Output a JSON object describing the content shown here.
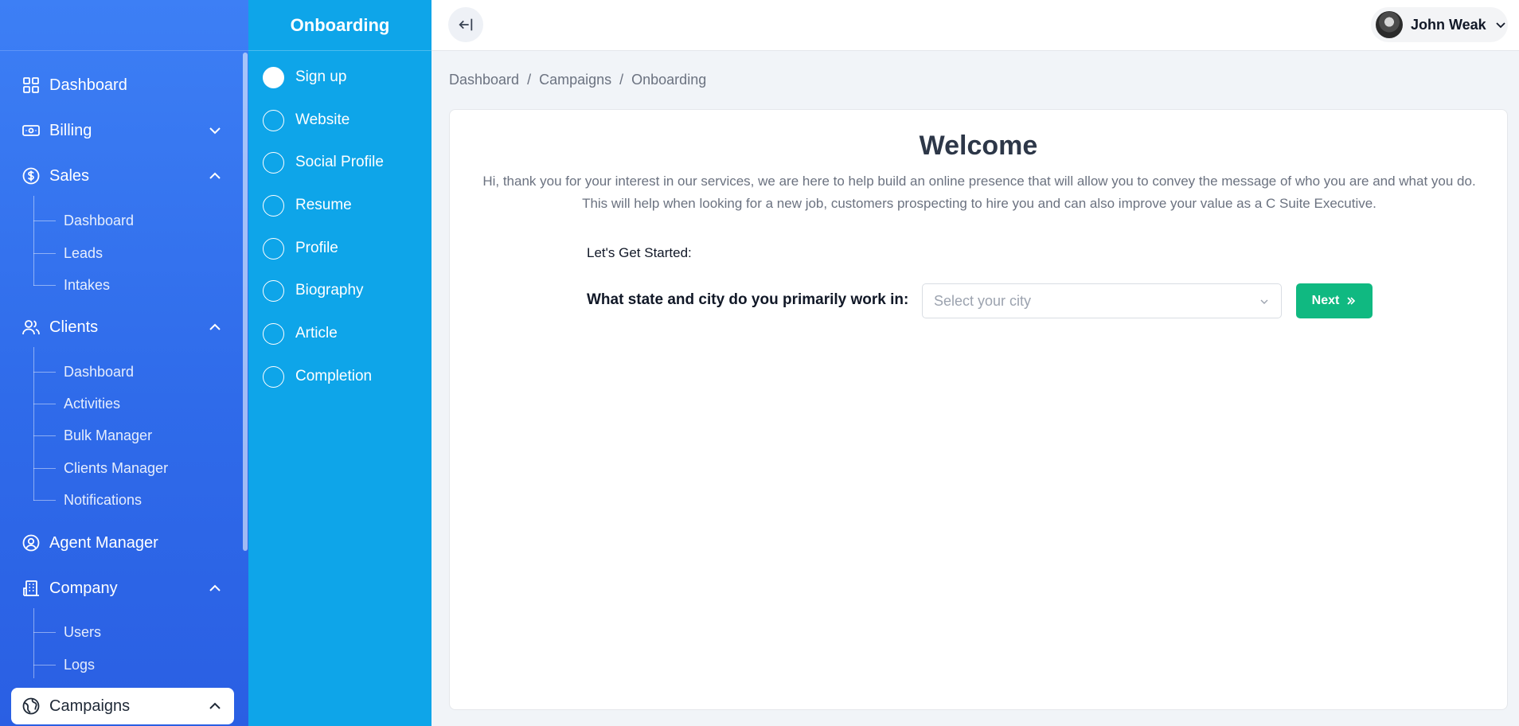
{
  "sidebar": {
    "items": [
      {
        "label": "Dashboard",
        "icon": "dashboard-grid-icon"
      },
      {
        "label": "Billing",
        "icon": "billing-card-icon",
        "expanded": false
      },
      {
        "label": "Sales",
        "icon": "dollar-circle-icon",
        "expanded": true,
        "children": [
          "Dashboard",
          "Leads",
          "Intakes"
        ]
      },
      {
        "label": "Clients",
        "icon": "users-icon",
        "expanded": true,
        "children": [
          "Dashboard",
          "Activities",
          "Bulk Manager",
          "Clients Manager",
          "Notifications"
        ]
      },
      {
        "label": "Agent Manager",
        "icon": "user-circle-icon"
      },
      {
        "label": "Company",
        "icon": "building-icon",
        "expanded": true,
        "children": [
          "Users",
          "Logs"
        ]
      },
      {
        "label": "Campaigns",
        "icon": "globe-icon",
        "expanded": true,
        "active": true
      }
    ]
  },
  "stepper": {
    "title": "Onboarding",
    "steps": [
      {
        "label": "Sign up",
        "done": true
      },
      {
        "label": "Website",
        "done": false
      },
      {
        "label": "Social Profile",
        "done": false
      },
      {
        "label": "Resume",
        "done": false
      },
      {
        "label": "Profile",
        "done": false
      },
      {
        "label": "Biography",
        "done": false
      },
      {
        "label": "Article",
        "done": false
      },
      {
        "label": "Completion",
        "done": false
      }
    ]
  },
  "header": {
    "user_name": "John Weak"
  },
  "breadcrumb": {
    "items": [
      "Dashboard",
      "Campaigns",
      "Onboarding"
    ],
    "separator": "/"
  },
  "main": {
    "title": "Welcome",
    "intro": "Hi, thank you for your interest in our services, we are here to help build an online presence that will allow you to convey the message of who you are and what you do. This will help when looking for a new job, customers prospecting to hire you and can also improve your value as a C Suite Executive.",
    "started_label": "Let's Get Started:",
    "question": "What state and city do you primarily work in:",
    "city_placeholder": "Select your city",
    "next_label": "Next"
  },
  "colors": {
    "sidebar": "#2f6bea",
    "stepper": "#0ea5e9",
    "next_button": "#10b981"
  }
}
